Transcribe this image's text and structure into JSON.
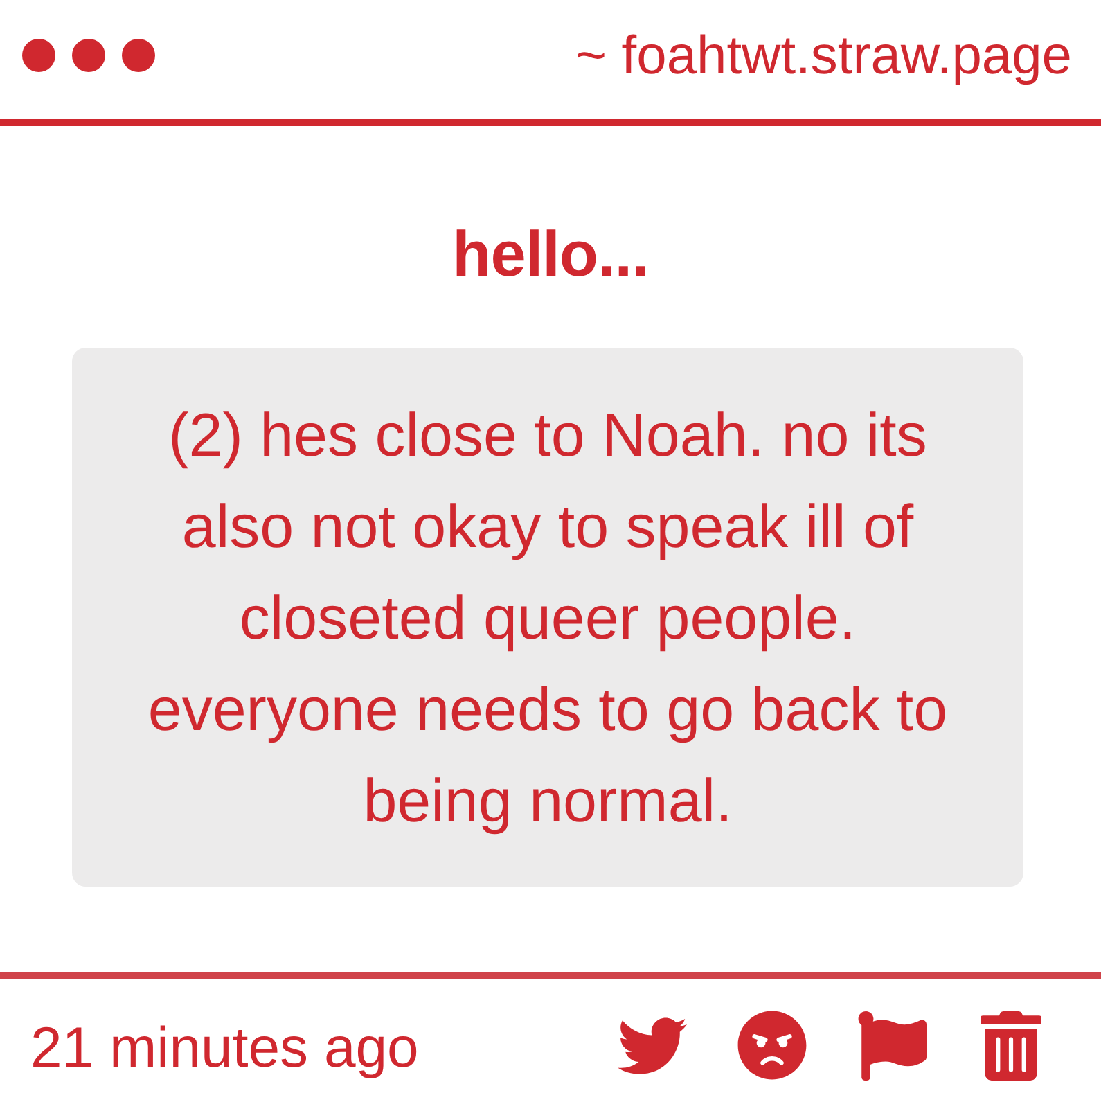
{
  "header": {
    "url": "~ foahtwt.straw.page"
  },
  "title": "hello...",
  "message": "(2) hes close to Noah. no its also not okay to speak ill of closeted queer people. everyone needs to go back to being normal.",
  "footer": {
    "time": "21 minutes ago",
    "actions": [
      {
        "kind": "twitter"
      },
      {
        "kind": "angry"
      },
      {
        "kind": "flag"
      },
      {
        "kind": "trash"
      }
    ]
  }
}
